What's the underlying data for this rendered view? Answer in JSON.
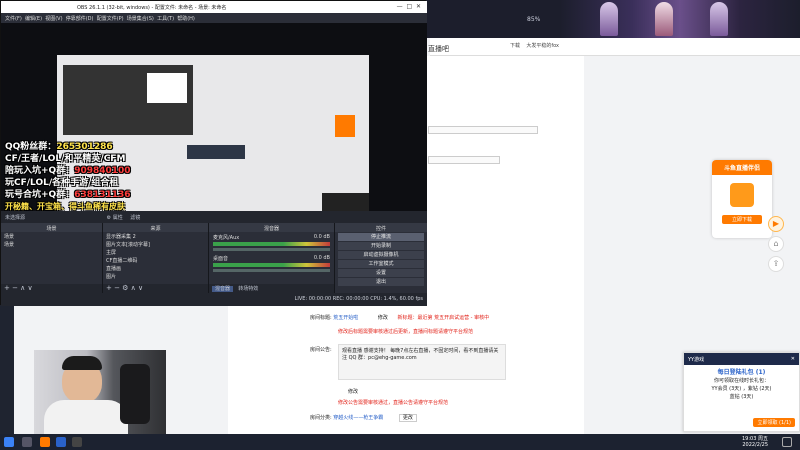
{
  "browser": {
    "zoom": "85%",
    "page_title_fragment": "直播吧",
    "toolbar_items": [
      "下载",
      "大发平稳的fox"
    ],
    "right_float": {
      "title": "斗鱼直播伴侣",
      "button": "立即下载"
    }
  },
  "page": {
    "rows": [
      {
        "label": "房间标题:",
        "value": "荒五开始啦",
        "action": "修改",
        "note": "新标题：最近第 荒五开启试运营 - 审核中",
        "note_class": "red"
      },
      {
        "label": "",
        "value": "修改后标题需要审核通过后更新，直播间标题请遵守平台规范",
        "note_class": "red"
      },
      {
        "label": "房间公告:",
        "value": "观看直播 感谢支持！ 每晚7点左右直播，不固定时间，看不到直播请关注 QQ 群：pc@ehg-game.com",
        "action": "修改"
      },
      {
        "label": "",
        "value": "修改公告需要审核通过，直播公告请遵守平台规范",
        "note_class": "red"
      },
      {
        "label": "房间分类:",
        "value": "穿越火线——枪王争霸",
        "action": "更改"
      }
    ]
  },
  "obs": {
    "title": "OBS 26.1.1 (32-bit, windows) - 配置文件: 未命名 - 场景: 未命名",
    "menu": [
      "文件(F)",
      "编辑(E)",
      "视图(V)",
      "停靠部件(D)",
      "配置文件(P)",
      "场景集合(S)",
      "工具(T)",
      "帮助(H)"
    ],
    "overlay_lines": [
      {
        "text": "QQ粉丝群：",
        "hl": "265301286"
      },
      {
        "text": "CF/王者/LOL/和平精英/CFM",
        "hl": ""
      },
      {
        "text": "陪玩入坑+Q群：",
        "hl": "909840100"
      },
      {
        "text": "玩CF/LOL/各种手游/组合租",
        "hl": ""
      },
      {
        "text": "玩号合坑+Q群：",
        "hl": "638131136"
      },
      {
        "text": "开秘籍、开宝箱、得斗鱼稀有皮肤",
        "hl": ""
      }
    ],
    "status_row": [
      "未选择源",
      "属性",
      "滤镜"
    ],
    "docks": {
      "scenes": {
        "title": "场景",
        "items": [
          "场景",
          "场景"
        ]
      },
      "sources": {
        "title": "来源",
        "items": [
          "显示器采集 2",
          "图片文本[滚动字幕]",
          "主屏",
          "CF直播二维码",
          "直播画",
          "图片"
        ]
      },
      "mixer": {
        "title": "混音器",
        "tracks": [
          {
            "name": "麦克风/Aux",
            "db": "0.0 dB"
          },
          {
            "name": "桌面音",
            "db": "0.0 dB"
          }
        ]
      },
      "transitions": {
        "title": "转场特效"
      },
      "controls": {
        "title": "控件",
        "buttons": [
          "停止推流",
          "开始录制",
          "启动虚拟摄像机",
          "工作室模式",
          "设置",
          "退出"
        ]
      }
    },
    "bottom_status": "LIVE: 00:00:00   REC: 00:00:00   CPU: 1.4%, 60.00 fps",
    "dock_foot_tabs": [
      "混音器",
      "转场特效"
    ]
  },
  "yy_popup": {
    "header": "YY游戏",
    "title": "每日登陆礼包 (1)",
    "lines": [
      "你可领取在线时长礼包：",
      "YY会员 (3天) ，紫钻 (2天)",
      "蓝钻 (3天)"
    ],
    "button": "立即领取 (1/1)"
  },
  "taskbar": {
    "time": "19:03 周五",
    "date": "2022/2/25"
  },
  "colors": {
    "accent": "#ff7a00",
    "obs_bg": "#2b2e38",
    "danger": "#e2231a"
  }
}
